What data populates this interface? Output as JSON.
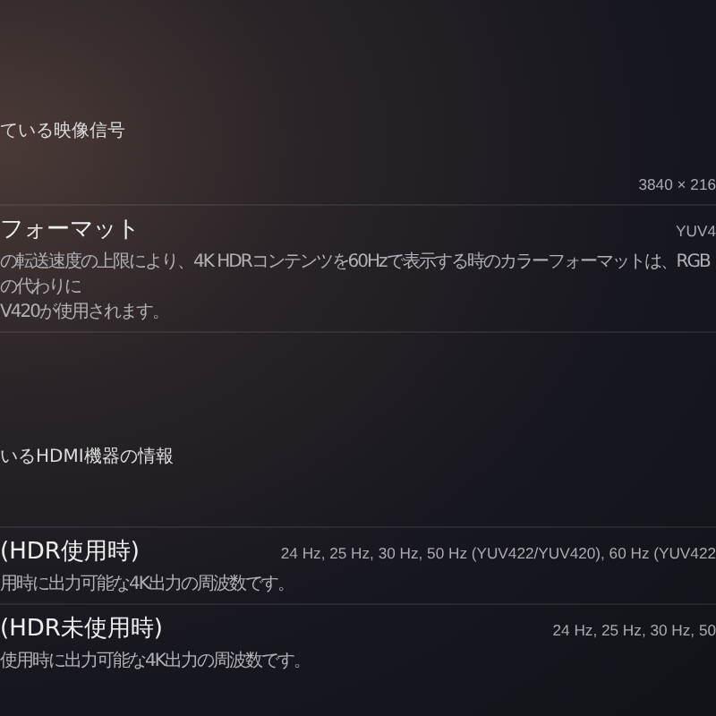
{
  "sections": [
    {
      "header": "ている映像信号",
      "rows": [
        {
          "title": "",
          "value": "3840 × 216",
          "description": ""
        },
        {
          "title": "フォーマット",
          "value": "YUV4",
          "description": "の転送速度の上限により、4K HDRコンテンツを60Hzで表示する時のカラーフォーマットは、RGBの代わりに\nV420が使用されます。"
        }
      ]
    },
    {
      "header": "いるHDMI機器の情報",
      "rows": [
        {
          "title": "(HDR使用時)",
          "value": "24 Hz, 25 Hz, 30 Hz, 50 Hz (YUV422/YUV420), 60 Hz (YUV422",
          "description": "用時に出力可能な4K出力の周波数です。"
        },
        {
          "title": "(HDR未使用時)",
          "value": "24 Hz, 25 Hz, 30 Hz, 50",
          "description": "使用時に出力可能な4K出力の周波数です。"
        }
      ]
    }
  ]
}
